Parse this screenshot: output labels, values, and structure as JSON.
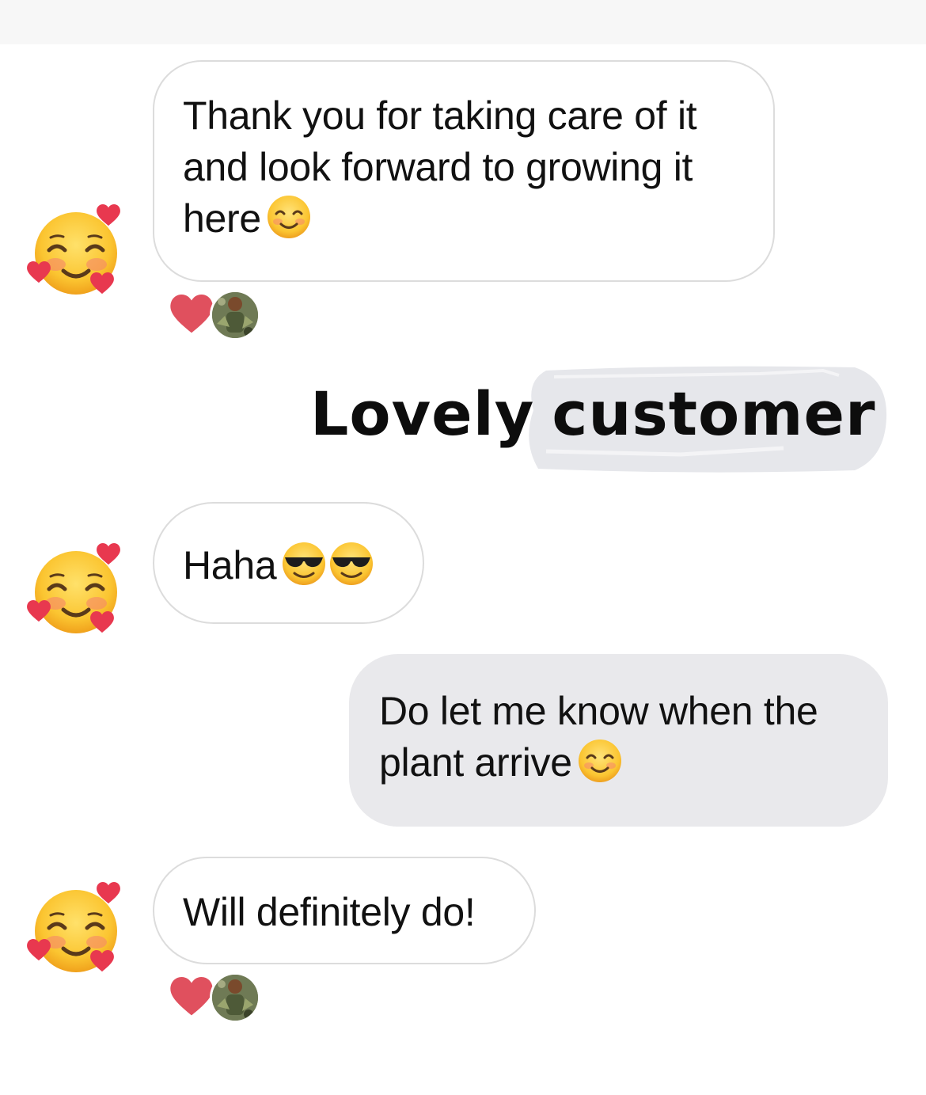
{
  "messages": [
    {
      "sender": "contact",
      "text": "Thank you for taking care of it and look forward to growing it here",
      "emoji": [
        "smiling-face-with-smiling-eyes"
      ],
      "reaction": "heart"
    },
    {
      "sender": "contact",
      "text": "Haha",
      "emoji": [
        "smiling-face-with-sunglasses",
        "smiling-face-with-sunglasses"
      ]
    },
    {
      "sender": "me",
      "text": "Do let me know when the plant arrive",
      "emoji": [
        "smiling-face-with-smiling-eyes"
      ]
    },
    {
      "sender": "contact",
      "text": "Will definitely do!",
      "reaction": "heart"
    }
  ],
  "overlay": {
    "caption_word1": "Lovely",
    "caption_word2": "customer"
  },
  "avatars": {
    "contact": "smiling-face-with-hearts-icon",
    "reactor": "user-avatar"
  },
  "colors": {
    "incoming_bubble": "#ffffff",
    "incoming_border": "#dcdcdc",
    "outgoing_bubble": "#e9e9ec",
    "reaction_heart": "#e0505e"
  }
}
